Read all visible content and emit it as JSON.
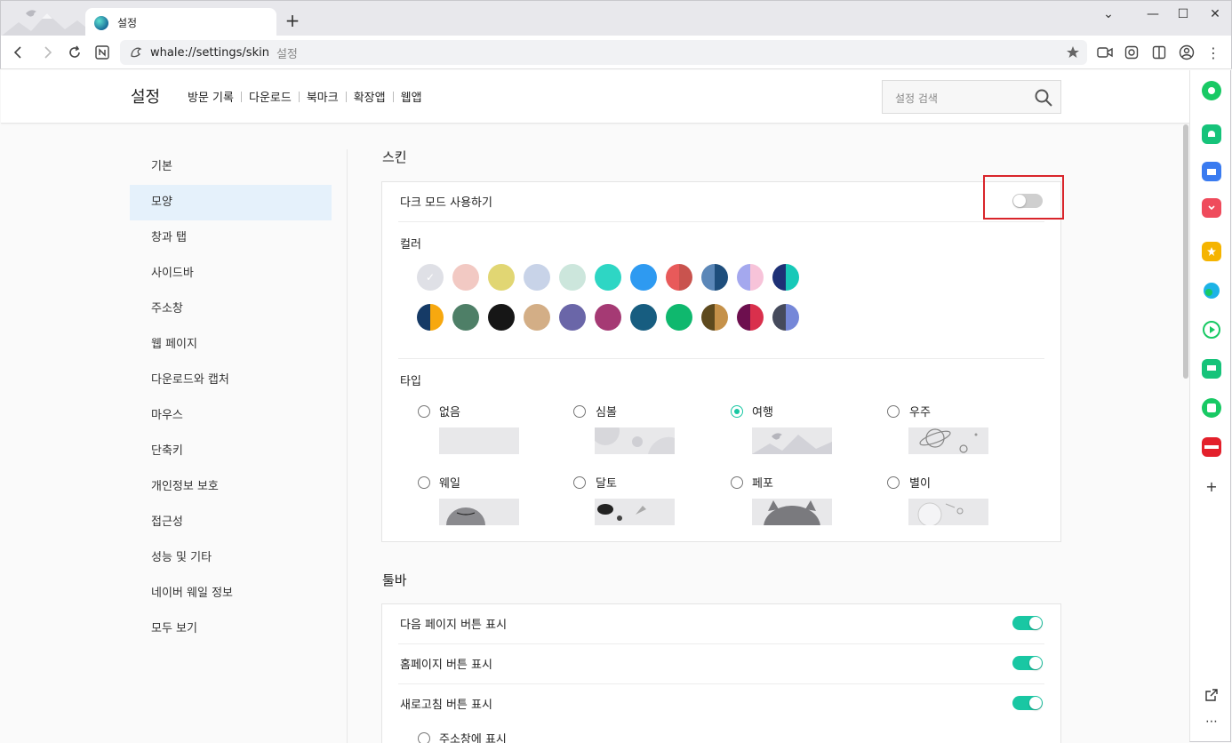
{
  "browser": {
    "tab_title": "설정",
    "new_tab": "+",
    "url": "whale://settings/skin",
    "url_hint": "설정"
  },
  "header": {
    "title": "설정",
    "links": [
      "방문 기록",
      "다운로드",
      "북마크",
      "확장앱",
      "웹앱"
    ],
    "search_placeholder": "설정 검색"
  },
  "nav": {
    "items": [
      "기본",
      "모양",
      "창과 탭",
      "사이드바",
      "주소창",
      "웹 페이지",
      "다운로드와 캡처",
      "마우스",
      "단축키",
      "개인정보 보호",
      "접근성",
      "성능 및 기타",
      "네이버 웨일 정보",
      "모두 보기"
    ],
    "active": "모양"
  },
  "skin": {
    "title": "스킨",
    "dark_mode_label": "다크 모드 사용하기",
    "dark_mode_on": false,
    "color_label": "컬러",
    "colors_row1": [
      "#dfe0e6",
      "#f2c9c3",
      "#e1d673",
      "#c8d3e8",
      "#cce6dc",
      "#2ed6c4",
      "#2e9af1",
      "split:#e85a5a:#c9534e",
      "split:#5b87b8:#1e4e7c",
      "split:#a4a8ee:#f7c3d9",
      "split:#1e3176:#17c9b8"
    ],
    "colors_row2": [
      "split:#153a66:#f7a80f",
      "#4e7f67",
      "#161616",
      "#d3ae86",
      "#6a66a8",
      "#a53a74",
      "#175d80",
      "#0fb86e",
      "split:#5e4a1e:#c59149",
      "split:#6d0f4e:#d9304c",
      "split:#454a5c:#7587d8"
    ],
    "selected_color_index": 0,
    "type_label": "타입",
    "types": [
      "없음",
      "심볼",
      "여행",
      "우주",
      "웨일",
      "달토",
      "페포",
      "별이"
    ],
    "selected_type": "여행"
  },
  "toolbar": {
    "title": "툴바",
    "items": [
      {
        "label": "다음 페이지 버튼 표시",
        "on": true
      },
      {
        "label": "홈페이지 버튼 표시",
        "on": true
      },
      {
        "label": "새로고침 버튼 표시",
        "on": true
      }
    ],
    "sub_option": "주소창에 표시"
  }
}
